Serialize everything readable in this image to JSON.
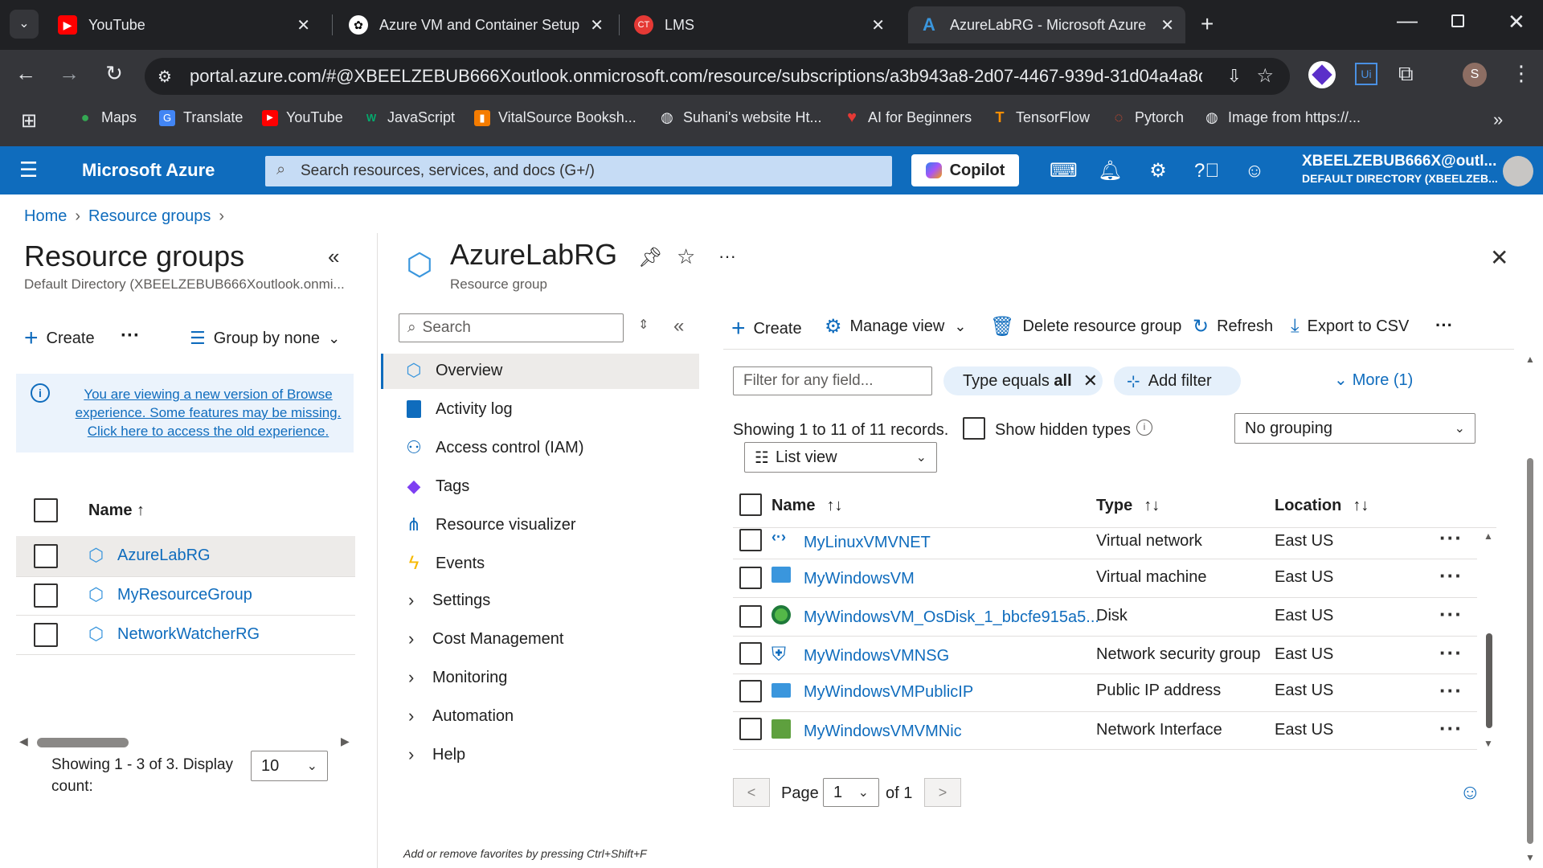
{
  "browser": {
    "tabs": [
      {
        "title": "YouTube",
        "icon": "youtube-icon"
      },
      {
        "title": "Azure VM and Container Setup",
        "icon": "openai-icon"
      },
      {
        "title": "LMS",
        "icon": "lms-icon"
      },
      {
        "title": "AzureLabRG - Microsoft Azure",
        "icon": "azure-icon"
      }
    ],
    "url": "portal.azure.com/#@XBEELZEBUB666Xoutlook.onmicrosoft.com/resource/subscriptions/a3b943a8-2d07-4467-939d-31d04a4a8d7c/r...",
    "profile_initial": "S",
    "bookmarks": [
      "Maps",
      "Translate",
      "YouTube",
      "JavaScript",
      "VitalSource Booksh...",
      "Suhani's website Ht...",
      "AI for Beginners",
      "TensorFlow",
      "Pytorch",
      "Image from https://..."
    ]
  },
  "azure_header": {
    "brand": "Microsoft Azure",
    "search_placeholder": "Search resources, services, and docs (G+/)",
    "copilot_label": "Copilot",
    "account_name": "XBEELZEBUB666X@outl...",
    "account_directory": "DEFAULT DIRECTORY (XBEELZEB..."
  },
  "breadcrumb": [
    "Home",
    "Resource groups"
  ],
  "left_panel": {
    "title": "Resource groups",
    "subtitle": "Default Directory (XBEELZEBUB666Xoutlook.onmi...",
    "create_label": "Create",
    "group_by_label": "Group by none",
    "info_text": "You are viewing a new version of Browse experience. Some features may be missing. Click here to access the old experience.",
    "name_header": "Name ↑",
    "groups": [
      "AzureLabRG",
      "MyResourceGroup",
      "NetworkWatcherRG"
    ],
    "footer_text": "Showing 1 - 3 of 3. Display count:",
    "display_count": "10"
  },
  "resource_group": {
    "title": "AzureLabRG",
    "subtitle": "Resource group",
    "search_placeholder": "Search",
    "menu": [
      {
        "label": "Overview",
        "icon": "overview-icon",
        "expandable": false,
        "selected": true
      },
      {
        "label": "Activity log",
        "icon": "activity-log-icon",
        "expandable": false
      },
      {
        "label": "Access control (IAM)",
        "icon": "iam-icon",
        "expandable": false
      },
      {
        "label": "Tags",
        "icon": "tag-icon",
        "expandable": false
      },
      {
        "label": "Resource visualizer",
        "icon": "visualizer-icon",
        "expandable": false
      },
      {
        "label": "Events",
        "icon": "events-icon",
        "expandable": false
      },
      {
        "label": "Settings",
        "expandable": true
      },
      {
        "label": "Cost Management",
        "expandable": true
      },
      {
        "label": "Monitoring",
        "expandable": true
      },
      {
        "label": "Automation",
        "expandable": true
      },
      {
        "label": "Help",
        "expandable": true
      }
    ],
    "footer_hint": "Add or remove favorites by pressing Ctrl+Shift+F"
  },
  "toolbar": {
    "create": "Create",
    "manage_view": "Manage view",
    "delete": "Delete resource group",
    "refresh": "Refresh",
    "export": "Export to CSV"
  },
  "filters": {
    "filter_placeholder": "Filter for any field...",
    "type_filter_prefix": "Type equals ",
    "type_filter_value": "all",
    "add_filter": "Add filter",
    "more": "More (1)",
    "records_text": "Showing 1 to 11 of 11 records.",
    "show_hidden": "Show hidden types",
    "grouping": "No grouping",
    "view": "List view"
  },
  "table": {
    "headers": {
      "name": "Name",
      "type": "Type",
      "location": "Location"
    },
    "rows": [
      {
        "name": "MyLinuxVMVNET",
        "type": "Virtual network",
        "location": "East US",
        "icon": "vnet-icon"
      },
      {
        "name": "MyWindowsVM",
        "type": "Virtual machine",
        "location": "East US",
        "icon": "vm-icon"
      },
      {
        "name": "MyWindowsVM_OsDisk_1_bbcfe915a5...",
        "type": "Disk",
        "location": "East US",
        "icon": "disk-icon"
      },
      {
        "name": "MyWindowsVMNSG",
        "type": "Network security group",
        "location": "East US",
        "icon": "nsg-icon"
      },
      {
        "name": "MyWindowsVMPublicIP",
        "type": "Public IP address",
        "location": "East US",
        "icon": "public-ip-icon"
      },
      {
        "name": "MyWindowsVMVMNic",
        "type": "Network Interface",
        "location": "East US",
        "icon": "nic-icon"
      }
    ]
  },
  "pagination": {
    "prev": "<",
    "page_label": "Page",
    "page_value": "1",
    "of_label": "of 1",
    "next": ">"
  },
  "colors": {
    "azure_blue": "#0f6cbd",
    "chrome_dark": "#202124",
    "chrome_mid": "#35363a"
  }
}
